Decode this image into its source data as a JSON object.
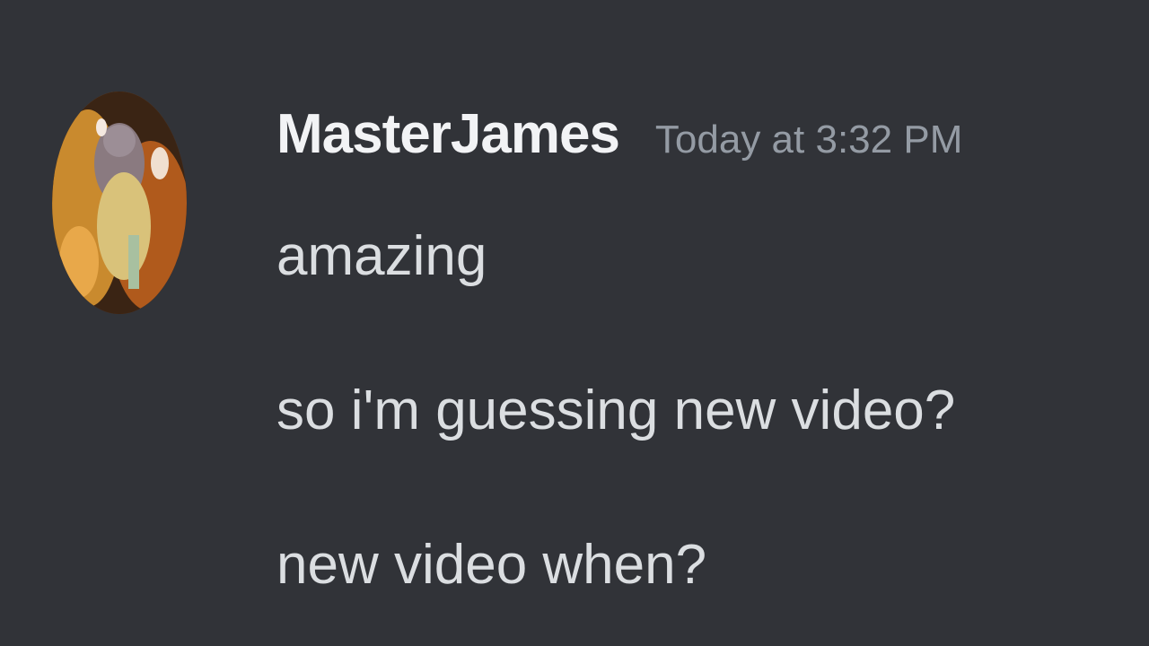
{
  "message": {
    "author": "MasterJames",
    "timestamp": "Today at 3:32 PM",
    "lines": [
      "amazing",
      "so i'm guessing new video?",
      "new video when?"
    ]
  },
  "colors": {
    "background": "#313338",
    "username": "#f2f3f5",
    "timestamp": "#949ba4",
    "message_text": "#dbdee1"
  },
  "icons": {
    "avatar": "user-avatar-image"
  }
}
